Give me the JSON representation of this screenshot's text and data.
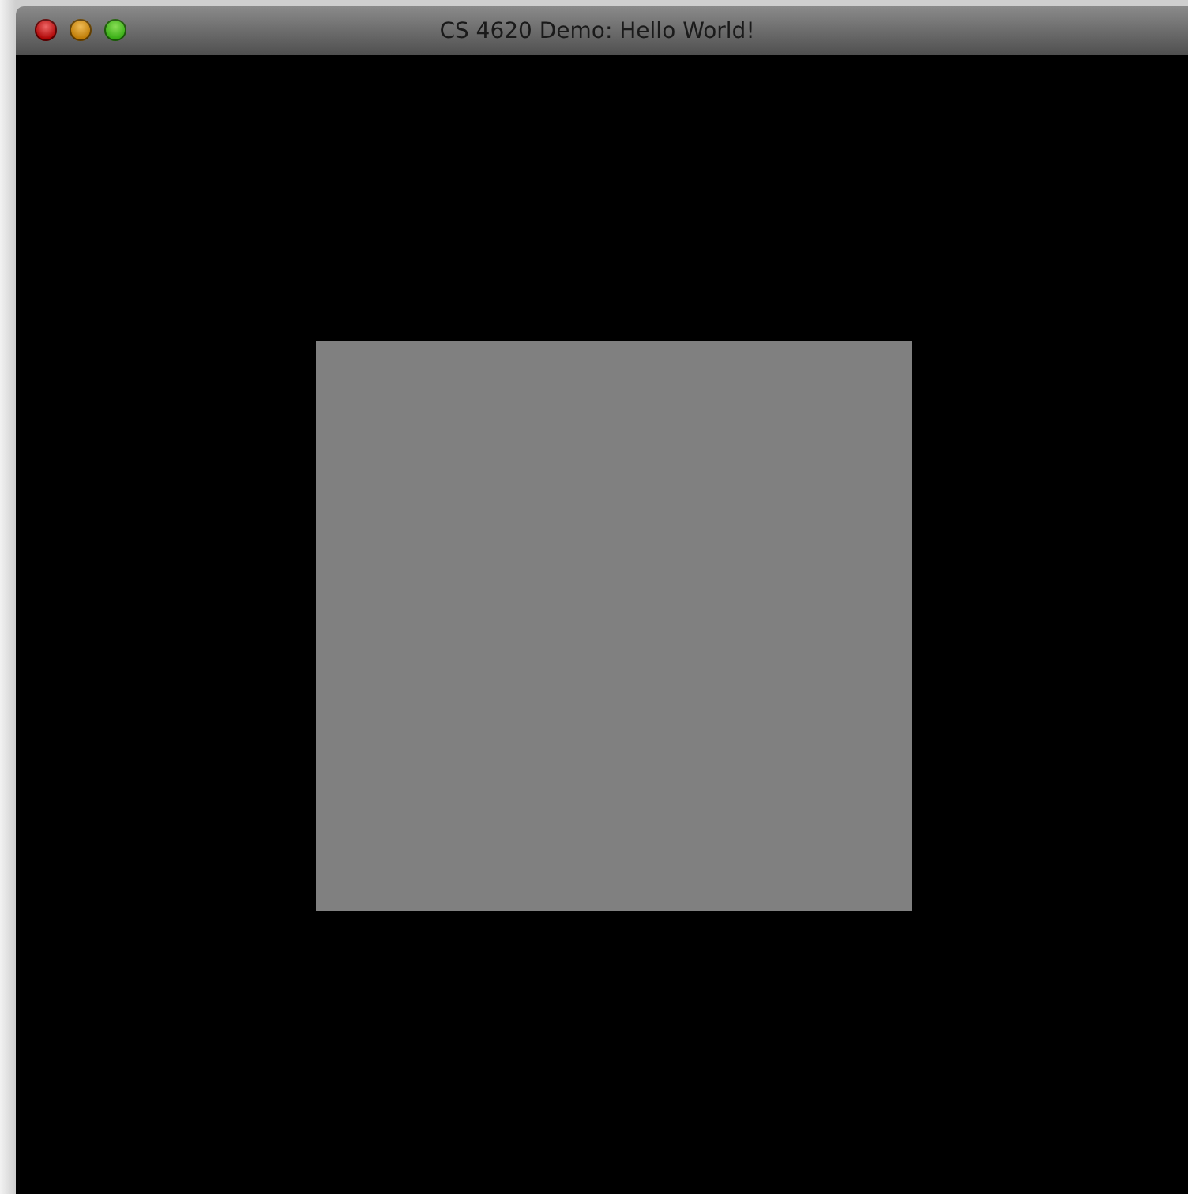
{
  "window": {
    "title": "CS 4620 Demo: Hello World!"
  }
}
